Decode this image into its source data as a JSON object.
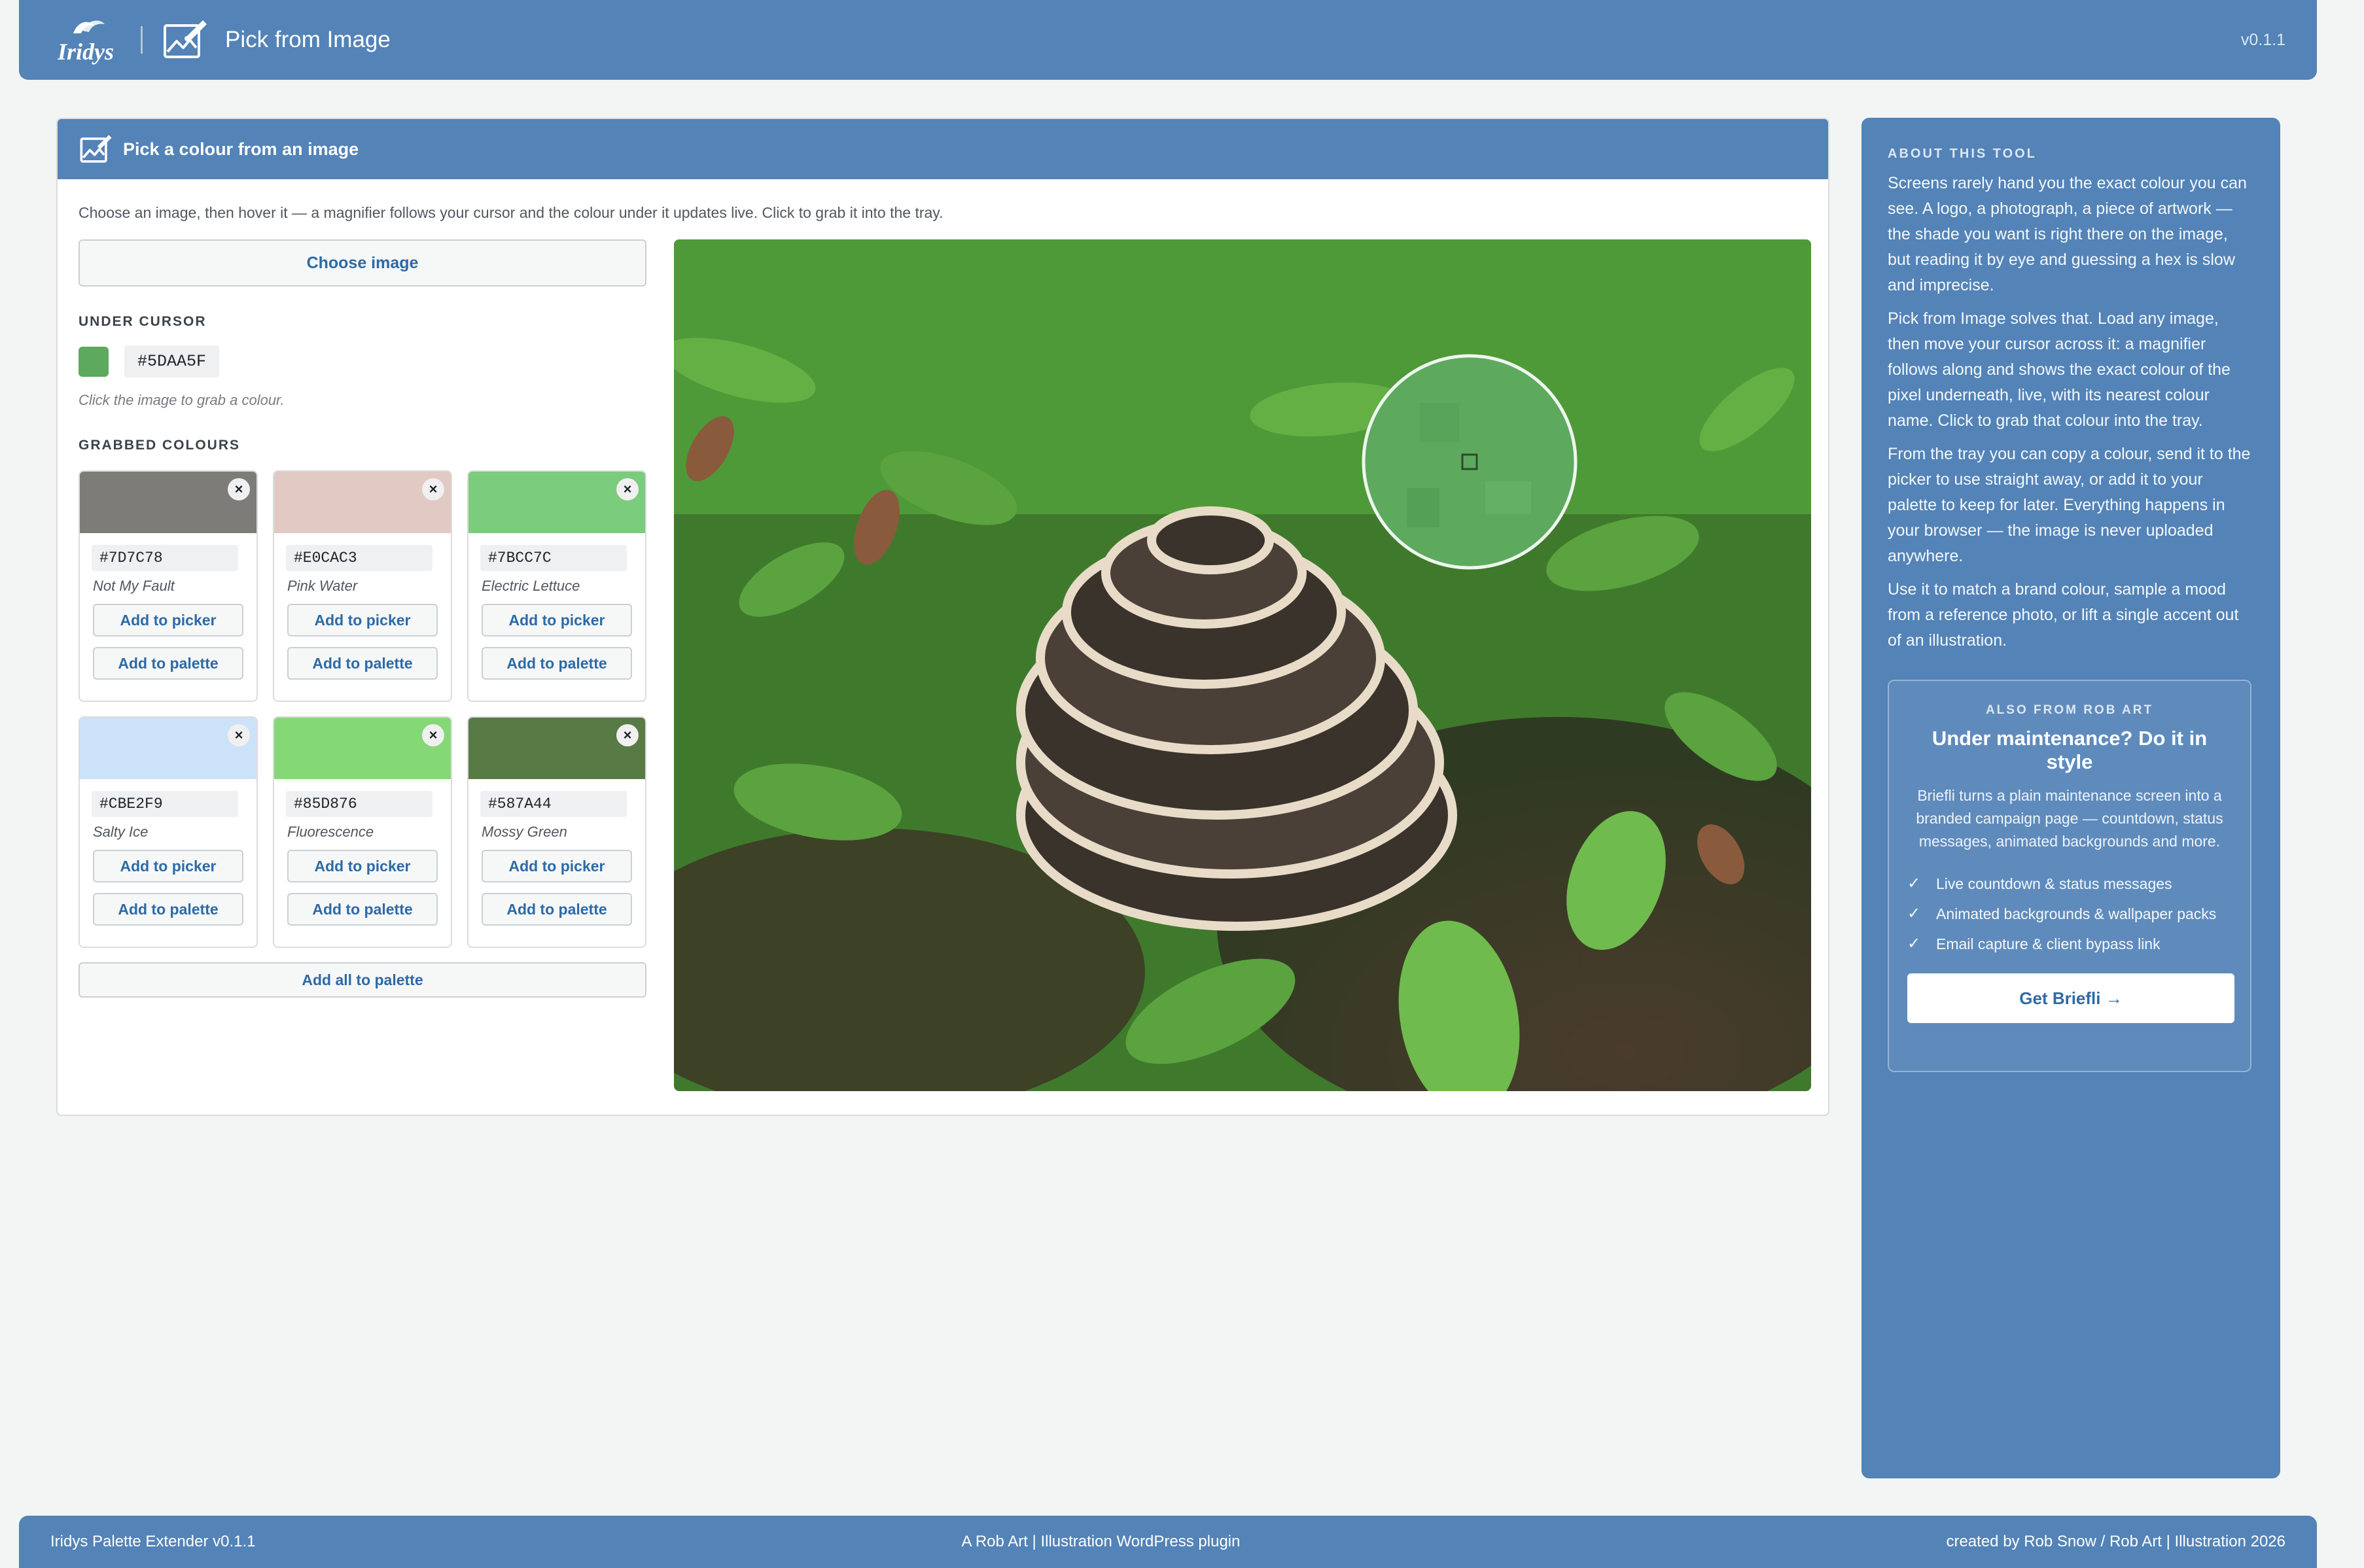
{
  "header": {
    "app_title": "Pick from Image",
    "version": "v0.1.1",
    "logo_text": "Iridys"
  },
  "card": {
    "title": "Pick a colour from an image",
    "intro": "Choose an image, then hover it — a magnifier follows your cursor and the colour under it updates live. Click to grab it into the tray.",
    "choose_button": "Choose image",
    "under_cursor_label": "UNDER CURSOR",
    "under_cursor_hex": "#5DAA5F",
    "hint": "Click the image to grab a colour.",
    "grabbed_label": "GRABBED COLOURS",
    "add_all_button": "Add all to palette"
  },
  "tiles": [
    {
      "hex": "#7D7C78",
      "name": "Not My Fault",
      "picker": "Add to picker",
      "palette": "Add to palette",
      "remove": "×"
    },
    {
      "hex": "#E0CAC3",
      "name": "Pink Water",
      "picker": "Add to picker",
      "palette": "Add to palette",
      "remove": "×"
    },
    {
      "hex": "#7BCC7C",
      "name": "Electric Lettuce",
      "picker": "Add to picker",
      "palette": "Add to palette",
      "remove": "×"
    },
    {
      "hex": "#CBE2F9",
      "name": "Salty Ice",
      "picker": "Add to picker",
      "palette": "Add to palette",
      "remove": "×"
    },
    {
      "hex": "#85D876",
      "name": "Fluorescence",
      "picker": "Add to picker",
      "palette": "Add to palette",
      "remove": "×"
    },
    {
      "hex": "#587A44",
      "name": "Mossy Green",
      "picker": "Add to picker",
      "palette": "Add to palette",
      "remove": "×"
    }
  ],
  "sidebar": {
    "heading": "ABOUT THIS TOOL",
    "paragraphs": [
      "Screens rarely hand you the exact colour you can see. A logo, a photograph, a piece of artwork — the shade you want is right there on the image, but reading it by eye and guessing a hex is slow and imprecise.",
      "Pick from Image solves that. Load any image, then move your cursor across it: a magnifier follows along and shows the exact colour of the pixel underneath, live, with its nearest colour name. Click to grab that colour into the tray.",
      "From the tray you can copy a colour, send it to the picker to use straight away, or add it to your palette to keep for later. Everything happens in your browser — the image is never uploaded anywhere.",
      "Use it to match a brand colour, sample a mood from a reference photo, or lift a single accent out of an illustration."
    ],
    "promo": {
      "kicker": "ALSO FROM ROB ART",
      "title": "Under maintenance? Do it in style",
      "desc": "Briefli turns a plain maintenance screen into a branded campaign page — countdown, status messages, animated backgrounds and more.",
      "features": [
        "Live countdown & status messages",
        "Animated backgrounds & wallpaper packs",
        "Email capture & client bypass link"
      ],
      "check": "✓",
      "button": "Get Briefli →"
    }
  },
  "footer": {
    "left": "Iridys Palette Extender v0.1.1",
    "center": "A Rob Art | Illustration WordPress plugin",
    "right": "created by Rob Snow / Rob Art | Illustration 2026"
  },
  "colors": {
    "brand": "#5383B7",
    "under_cursor_swatch": "#5DAA5F"
  }
}
